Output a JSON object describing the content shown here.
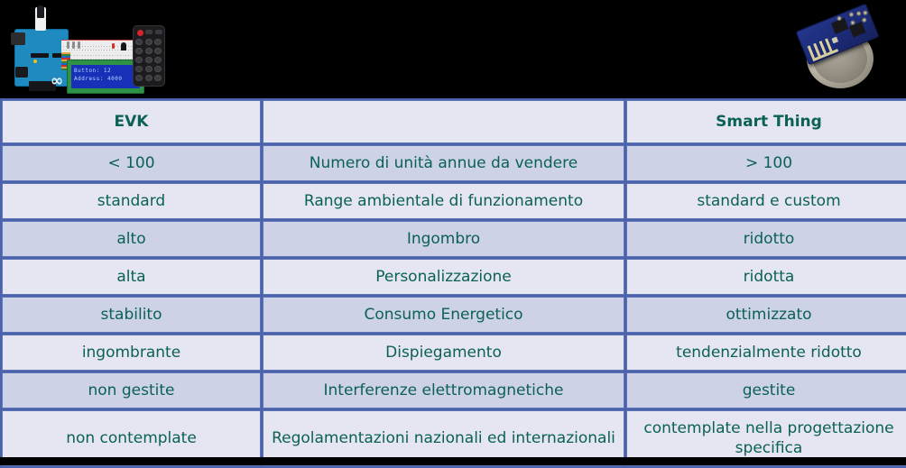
{
  "media": {
    "left_photo": {
      "name": "arduino-breadboard-lcd-remote-photo",
      "lcd_line1": "Button: 12",
      "lcd_line2": "Address: 4000",
      "board_logo": "∞"
    },
    "right_photo": {
      "name": "esp8266-module-on-coin-photo"
    }
  },
  "table": {
    "headers": {
      "left": "EVK",
      "middle": "",
      "right": "Smart Thing"
    },
    "rows": [
      {
        "left": "< 100",
        "criterion": "Numero di unità annue da vendere",
        "right": "> 100"
      },
      {
        "left": "standard",
        "criterion": "Range ambientale di funzionamento",
        "right": "standard e custom"
      },
      {
        "left": "alto",
        "criterion": "Ingombro",
        "right": "ridotto"
      },
      {
        "left": "alta",
        "criterion": "Personalizzazione",
        "right": "ridotta"
      },
      {
        "left": "stabilito",
        "criterion": "Consumo Energetico",
        "right": "ottimizzato"
      },
      {
        "left": "ingombrante",
        "criterion": "Dispiegamento",
        "right": "tendenzialmente ridotto"
      },
      {
        "left": "non gestite",
        "criterion": "Interferenze elettromagnetiche",
        "right": "gestite"
      },
      {
        "left": "non contemplate",
        "criterion": "Regolamentazioni nazionali ed internazionali",
        "right": "contemplate nella progettazione specifica"
      }
    ]
  },
  "colors": {
    "background": "#000000",
    "text_teal": "#0b6155",
    "row_light": "#e5e6f2",
    "row_dark": "#ced2e6",
    "grid_blue": "#5d73b8"
  }
}
